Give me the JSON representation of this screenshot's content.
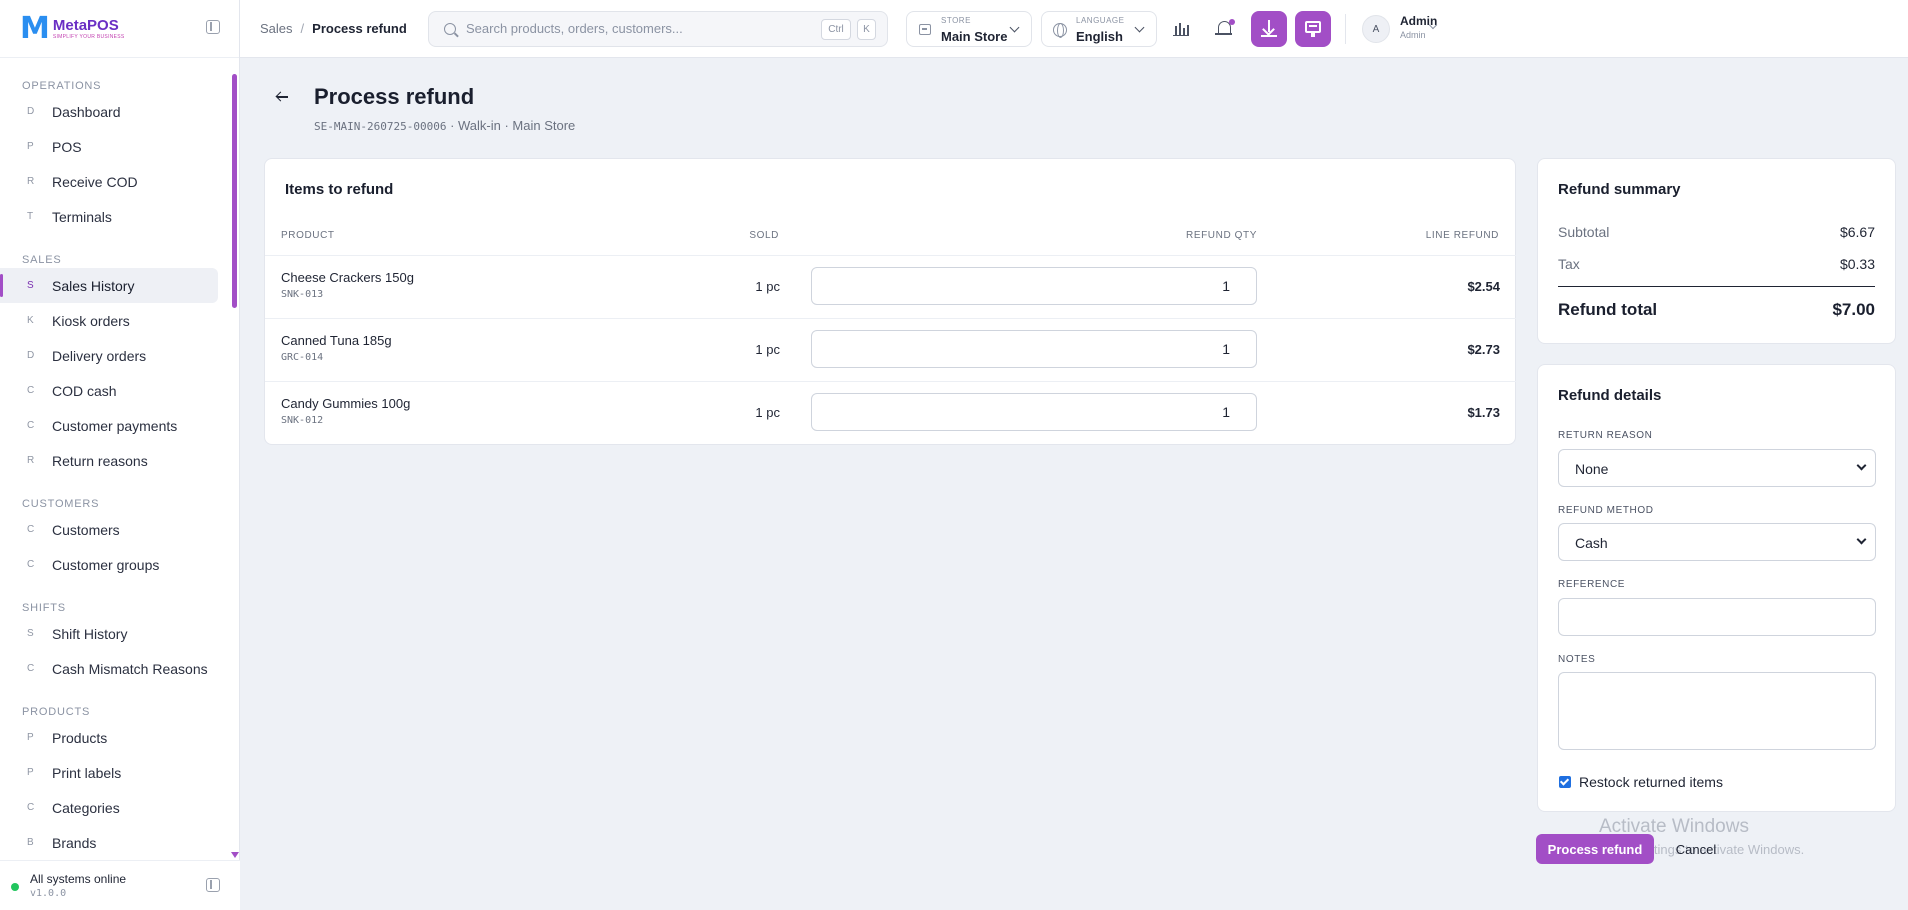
{
  "brand": {
    "name": "MetaPOS",
    "tagline": "SIMPLIFY YOUR BUSINESS",
    "accent": "#a24ec6"
  },
  "sidebar": {
    "sections": [
      {
        "title": "OPERATIONS",
        "items": [
          {
            "letter": "D",
            "label": "Dashboard"
          },
          {
            "letter": "P",
            "label": "POS"
          },
          {
            "letter": "R",
            "label": "Receive COD"
          },
          {
            "letter": "T",
            "label": "Terminals"
          }
        ]
      },
      {
        "title": "SALES",
        "items": [
          {
            "letter": "S",
            "label": "Sales History",
            "active": true
          },
          {
            "letter": "K",
            "label": "Kiosk orders"
          },
          {
            "letter": "D",
            "label": "Delivery orders"
          },
          {
            "letter": "C",
            "label": "COD cash"
          },
          {
            "letter": "C",
            "label": "Customer payments"
          },
          {
            "letter": "R",
            "label": "Return reasons"
          }
        ]
      },
      {
        "title": "CUSTOMERS",
        "items": [
          {
            "letter": "C",
            "label": "Customers"
          },
          {
            "letter": "C",
            "label": "Customer groups"
          }
        ]
      },
      {
        "title": "SHIFTS",
        "items": [
          {
            "letter": "S",
            "label": "Shift History"
          },
          {
            "letter": "C",
            "label": "Cash Mismatch Reasons"
          }
        ]
      },
      {
        "title": "PRODUCTS",
        "items": [
          {
            "letter": "P",
            "label": "Products"
          },
          {
            "letter": "P",
            "label": "Print labels"
          },
          {
            "letter": "C",
            "label": "Categories"
          },
          {
            "letter": "B",
            "label": "Brands"
          }
        ]
      }
    ],
    "footer": {
      "status": "All systems online",
      "version": "v1.0.0"
    }
  },
  "topbar": {
    "breadcrumb": {
      "parent": "Sales",
      "separator": "/",
      "current": "Process refund"
    },
    "search": {
      "placeholder": "Search products, orders, customers...",
      "kbd1": "Ctrl",
      "kbd2": "K"
    },
    "store": {
      "caption": "STORE",
      "value": "Main Store"
    },
    "language": {
      "caption": "LANGUAGE",
      "value": "English"
    },
    "icons": [
      "chart-icon",
      "bell-icon",
      "download-icon",
      "pos-icon"
    ],
    "user": {
      "avatar": "A",
      "name": "Admin",
      "role": "Admin"
    }
  },
  "page": {
    "title": "Process refund",
    "code": "SE-MAIN-260725-00006",
    "meta": " · Walk-in · Main Store"
  },
  "items_card": {
    "title": "Items to refund",
    "columns": {
      "product": "PRODUCT",
      "sold": "SOLD",
      "qty": "REFUND QTY",
      "line": "LINE REFUND"
    },
    "rows": [
      {
        "name": "Cheese Crackers 150g",
        "sku": "SNK-013",
        "sold": "1 pc",
        "qty": "1",
        "line": "$2.54"
      },
      {
        "name": "Canned Tuna 185g",
        "sku": "GRC-014",
        "sold": "1 pc",
        "qty": "1",
        "line": "$2.73"
      },
      {
        "name": "Candy Gummies 100g",
        "sku": "SNK-012",
        "sold": "1 pc",
        "qty": "1",
        "line": "$1.73"
      }
    ]
  },
  "summary": {
    "title": "Refund summary",
    "subtotal_label": "Subtotal",
    "subtotal": "$6.67",
    "tax_label": "Tax",
    "tax": "$0.33",
    "total_label": "Refund total",
    "total": "$7.00"
  },
  "details": {
    "title": "Refund details",
    "reason_label": "RETURN REASON",
    "reason_value": "None",
    "method_label": "REFUND METHOD",
    "method_value": "Cash",
    "reference_label": "REFERENCE",
    "reference_value": "",
    "notes_label": "NOTES",
    "notes_value": "",
    "restock_label": "Restock returned items",
    "restock_checked": true
  },
  "actions": {
    "submit": "Process refund",
    "cancel": "Cancel"
  },
  "watermark": {
    "line1": "Activate Windows",
    "line2": "Go to Settings to activate Windows."
  }
}
